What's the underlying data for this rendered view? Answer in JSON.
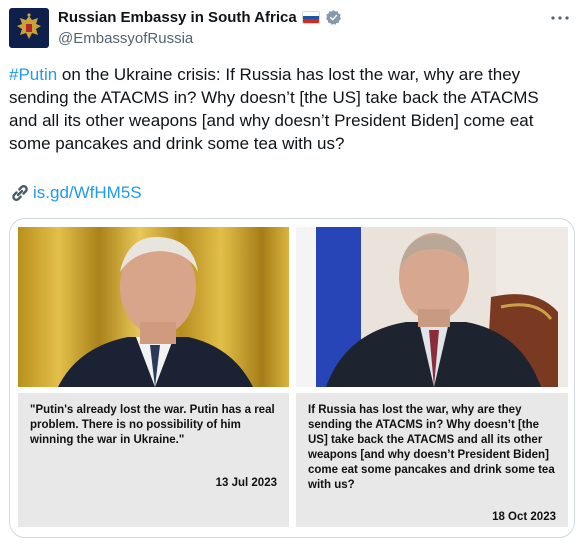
{
  "account": {
    "display_name": "Russian Embassy in South Africa",
    "handle": "@EmbassyofRussia",
    "flag_colors": [
      "#ffffff",
      "#1c57a7",
      "#d52b1e"
    ],
    "verified_color": "#829aab"
  },
  "tweet": {
    "hashtag": "#Putin",
    "text": " on the Ukraine crisis: If Russia has lost the war, why are they sending the ATACMS in? Why doesn’t [the US] take back the ATACMS and all its other weapons [and why doesn’t President Biden] come eat some pancakes and drink some tea with us?",
    "link_icon": "link-icon",
    "link_text": "is.gd/WfHM5S"
  },
  "media": {
    "left": {
      "quote": "\"Putin's already lost the war. Putin has a real problem. There is no possibility of him winning the war in Ukraine.\"",
      "date": "13 Jul 2023"
    },
    "right": {
      "quote": "If Russia has lost the war, why are they sending the ATACMS in? Why doesn’t [the US] take back the ATACMS and all its other weapons [and why doesn’t President Biden] come eat some pancakes and drink some tea with us?",
      "date": "18 Oct 2023"
    }
  },
  "colors": {
    "link": "#1d9bf0",
    "text": "#0f1419",
    "muted": "#536471",
    "caption_bg": "#e8e8e8"
  }
}
